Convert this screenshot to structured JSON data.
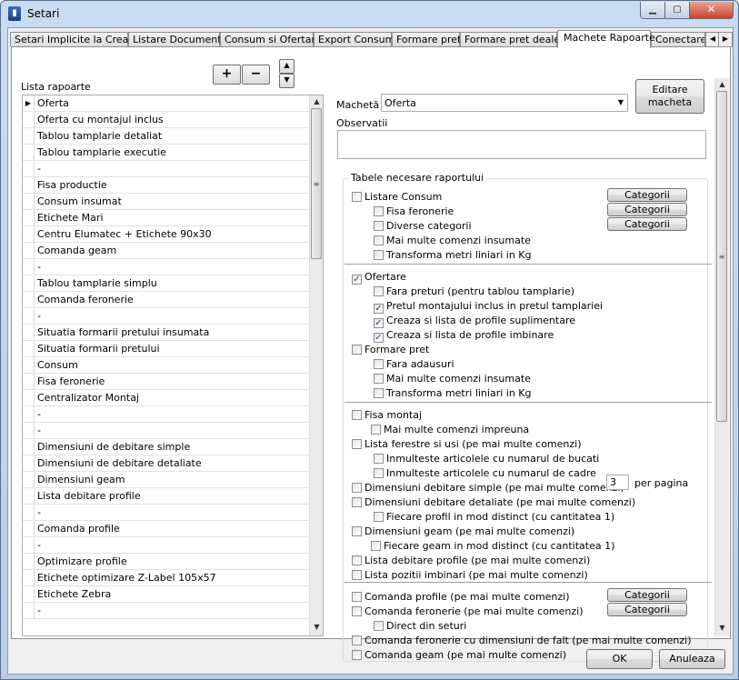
{
  "window": {
    "title": "Setari"
  },
  "tabs": [
    "Setari Implicite la Creare",
    "Listare Documente",
    "Consum si Ofertare",
    "Export Consum",
    "Formare pret",
    "Formare pret dealer",
    "Machete Rapoarte",
    "Conectare"
  ],
  "active_tab": "Machete Rapoarte",
  "left": {
    "list_label": "Lista rapoarte",
    "add_label": "+",
    "remove_label": "−",
    "reports": [
      "Oferta",
      "Oferta cu montajul inclus",
      "Tablou tamplarie detaliat",
      "Tablou tamplarie executie",
      "-",
      "Fisa productie",
      "Consum insumat",
      "Etichete Mari",
      "Centru Elumatec + Etichete 90x30",
      "Comanda geam",
      "-",
      "Tablou tamplarie simplu",
      "Comanda feronerie",
      "-",
      "Situatia formarii pretului insumata",
      "Situatia formarii pretului",
      "Consum",
      "Fisa feronerie",
      "Centralizator Montaj",
      "-",
      "-",
      "Dimensiuni de debitare simple",
      "Dimensiuni de debitare detaliate",
      "Dimensiuni geam",
      "Lista debitare profile",
      "-",
      "Comanda profile",
      "-",
      "Optimizare profile",
      "Etichete optimizare Z-Label 105x57",
      "Etichete Zebra",
      "-"
    ]
  },
  "right": {
    "macheta_label": "Machetă",
    "macheta_value": "Oferta",
    "edit_button": "Editare\nmacheta",
    "observatii_label": "Observatii",
    "tables_label": "Tabele necesare raportului",
    "category_button": "Categorii",
    "per_page_value": "3",
    "per_page_label": "per pagina",
    "items": [
      {
        "label": "Listare Consum",
        "checked": false
      },
      {
        "label": "Fisa feronerie",
        "checked": false
      },
      {
        "label": "Diverse categorii",
        "checked": false
      },
      {
        "label": "Mai multe comenzi insumate",
        "checked": false
      },
      {
        "label": "Transforma metri liniari in Kg",
        "checked": false
      },
      {
        "label": "Ofertare",
        "checked": true
      },
      {
        "label": "Fara preturi (pentru tablou tamplarie)",
        "checked": false
      },
      {
        "label": "Pretul montajului inclus in pretul tamplariei",
        "checked": true
      },
      {
        "label": "Creaza si lista de profile suplimentare",
        "checked": true
      },
      {
        "label": "Creaza si lista de profile imbinare",
        "checked": true
      },
      {
        "label": "Formare pret",
        "checked": false
      },
      {
        "label": "Fara adausuri",
        "checked": false
      },
      {
        "label": "Mai multe comenzi insumate",
        "checked": false
      },
      {
        "label": "Transforma metri liniari in Kg",
        "checked": false
      },
      {
        "label": "Fisa montaj",
        "checked": false
      },
      {
        "label": "Mai multe comenzi impreuna",
        "checked": false
      },
      {
        "label": "Lista ferestre si usi (pe mai multe comenzi)",
        "checked": false
      },
      {
        "label": "Inmulteste articolele cu numarul de bucati",
        "checked": false
      },
      {
        "label": "Inmulteste articolele cu numarul de cadre",
        "checked": false
      },
      {
        "label": "Dimensiuni debitare simple (pe mai multe comenzi)",
        "checked": false
      },
      {
        "label": "Dimensiuni debitare detaliate (pe mai multe comenzi)",
        "checked": false
      },
      {
        "label": "Fiecare profil in mod distinct (cu cantitatea 1)",
        "checked": false
      },
      {
        "label": "Dimensiuni geam (pe mai multe comenzi)",
        "checked": false
      },
      {
        "label": "Fiecare geam in mod distinct (cu cantitatea 1)",
        "checked": false
      },
      {
        "label": "Lista debitare profile (pe mai multe comenzi)",
        "checked": false
      },
      {
        "label": "Lista pozitii imbinari (pe mai multe comenzi)",
        "checked": false
      },
      {
        "label": "Comanda profile (pe mai multe comenzi)",
        "checked": false
      },
      {
        "label": "Comanda feronerie (pe mai multe comenzi)",
        "checked": false
      },
      {
        "label": "Direct din seturi",
        "checked": false
      },
      {
        "label": "Comanda feronerie cu dimensiuni de falt (pe mai multe comenzi)",
        "checked": false
      },
      {
        "label": "Comanda geam (pe mai multe comenzi)",
        "checked": false
      }
    ]
  },
  "footer": {
    "ok": "OK",
    "cancel": "Anuleaza"
  }
}
